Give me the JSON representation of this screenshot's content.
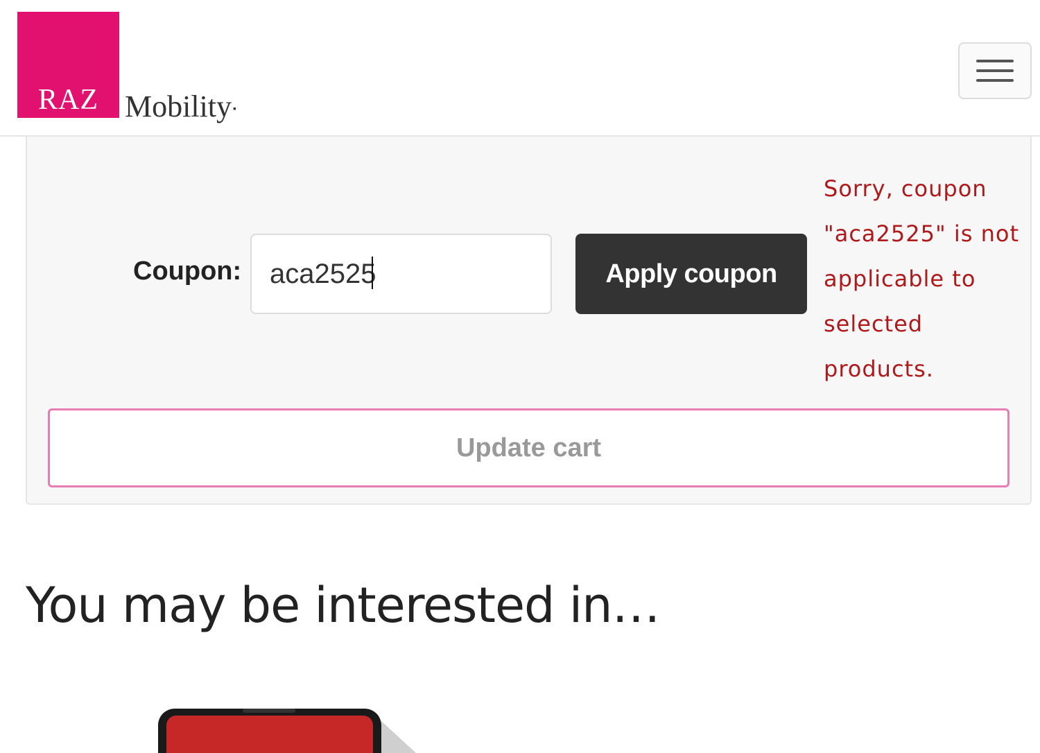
{
  "header": {
    "logo_raz": "RAZ",
    "logo_mobility": "Mobility",
    "logo_mark": "▪",
    "menu_icon": "hamburger-menu-icon"
  },
  "coupon": {
    "label": "Coupon:",
    "input_value": "aca2525",
    "apply_label": "Apply coupon",
    "error_message": "Sorry, coupon \"aca2525\" is not applicable to selected products.",
    "update_label": "Update cart"
  },
  "interested": {
    "title": "You may be interested in…"
  },
  "colors": {
    "brand": "#e2106f",
    "error": "#b0191b",
    "button_dark": "#333333",
    "update_border": "#e77db4"
  }
}
